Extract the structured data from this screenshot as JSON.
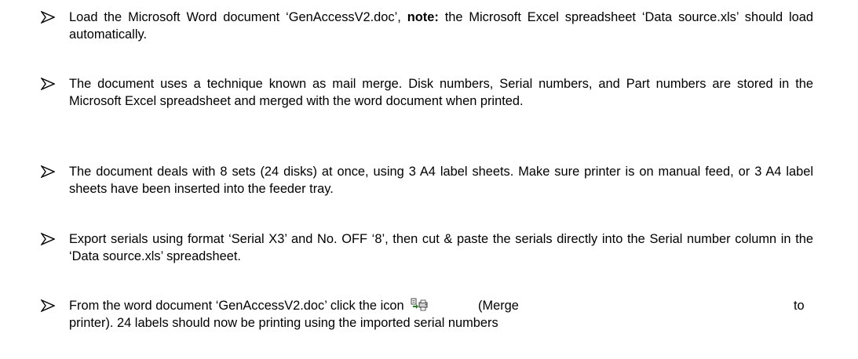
{
  "instructions": {
    "items": [
      {
        "before": "Load the Microsoft Word document ‘GenAccessV2.doc’, ",
        "bold": "note:",
        "after": " the Microsoft Excel spreadsheet ‘Data source.xls’ should load automatically."
      },
      {
        "text": "The document uses a technique known as mail merge. Disk numbers, Serial numbers, and Part numbers are stored in the Microsoft Excel spreadsheet and merged with the word document when printed."
      },
      {
        "text": "The document deals with 8 sets (24 disks) at once, using 3 A4 label sheets. Make sure printer is on manual feed, or 3 A4 label sheets have been inserted into the feeder tray."
      },
      {
        "text": "Export serials using format ‘Serial X3’ and No. OFF ‘8’, then cut & paste the serials directly into the Serial number column in the ‘Data source.xls’ spreadsheet."
      },
      {
        "line1_before": "From the word document ‘GenAccessV2.doc’ click the icon",
        "icon": "merge-to-printer-icon",
        "line1_label": "(Merge",
        "line1_to": "to",
        "line2": "printer). 24 labels should now be printing using the imported serial numbers"
      }
    ]
  }
}
